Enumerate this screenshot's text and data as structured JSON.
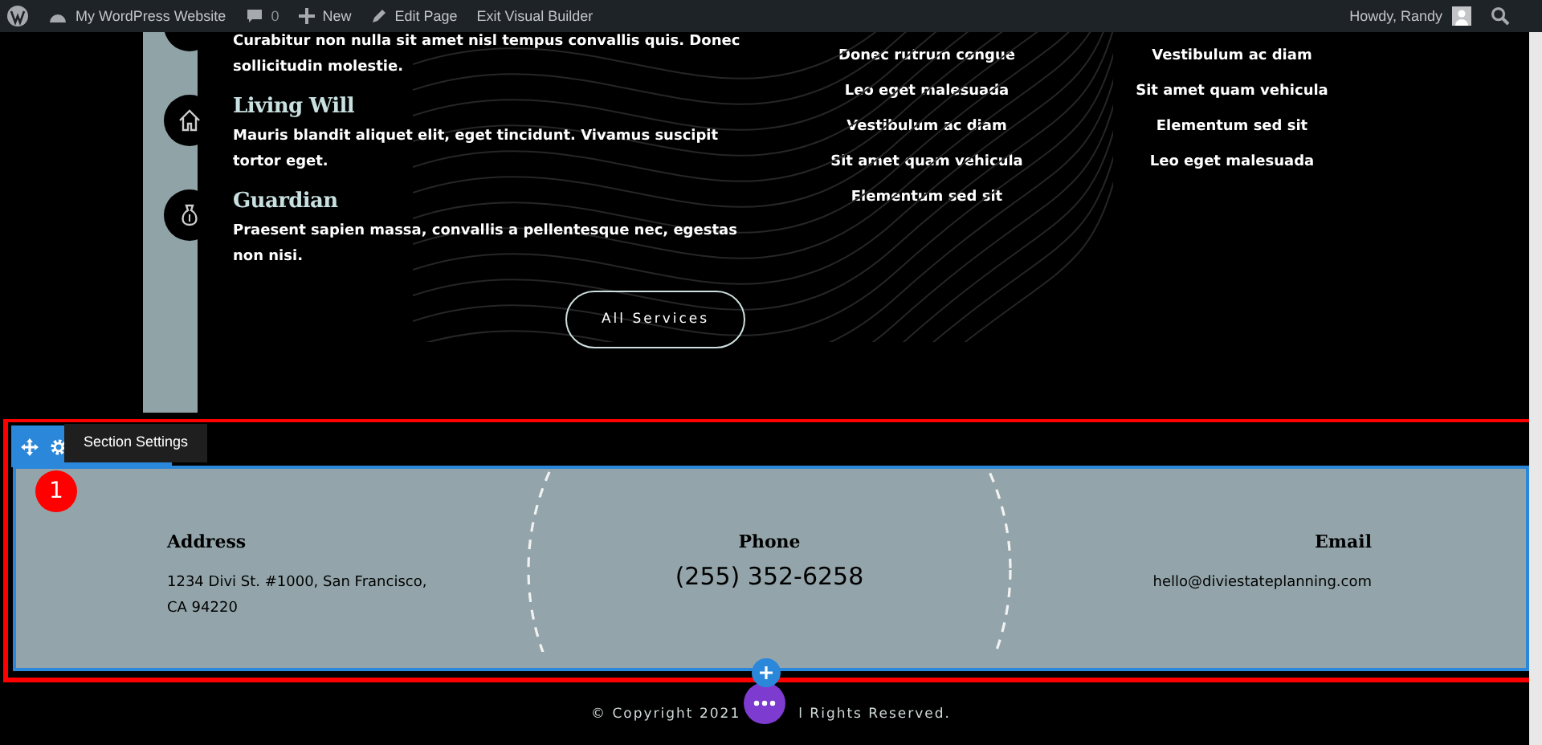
{
  "admin_bar": {
    "items": [
      {
        "kind": "wp-logo"
      },
      {
        "kind": "site",
        "label": "My WordPress Website"
      },
      {
        "kind": "comments",
        "label": "0"
      },
      {
        "kind": "new",
        "label": "New"
      },
      {
        "kind": "edit",
        "label": "Edit Page"
      },
      {
        "kind": "text",
        "label": "Exit Visual Builder"
      }
    ],
    "greeting": "Howdy, Randy"
  },
  "services": [
    {
      "kind": "blank",
      "text": "Curabitur non nulla sit amet nisl tempus convallis quis. Donec sollicitudin molestie."
    },
    {
      "kind": "house",
      "title": "Living Will",
      "text": "Mauris blandit aliquet elit, eget tincidunt. Vivamus suscipit tortor eget."
    },
    {
      "kind": "moneybag",
      "title": "Guardian",
      "text": "Praesent sapien massa, convallis a pellentesque nec, egestas non nisi."
    }
  ],
  "service_button": "All Services",
  "lists": [
    [
      "Donec rutrum congue",
      "Leo eget malesuada",
      "Vestibulum ac diam",
      "Sit amet quam vehicula",
      "Elementum sed sit"
    ],
    [
      "Vestibulum ac diam",
      "Sit amet quam vehicula",
      "Elementum sed sit",
      "Leo eget malesuada"
    ]
  ],
  "builder": {
    "tooltip": "Section Settings",
    "badge": "1"
  },
  "contact": [
    {
      "kind": "address",
      "heading": "Address",
      "lines": [
        "1234 Divi St. #1000, San Francisco,",
        "CA 94220"
      ]
    },
    {
      "kind": "phone",
      "heading": "Phone",
      "lines": [
        "(255) 352-6258"
      ]
    },
    {
      "kind": "email",
      "heading": "Email",
      "lines": [
        "hello@diviestateplanning.com"
      ]
    }
  ],
  "footer": [
    "© Copyright 2021",
    "l Rights Reserved."
  ]
}
